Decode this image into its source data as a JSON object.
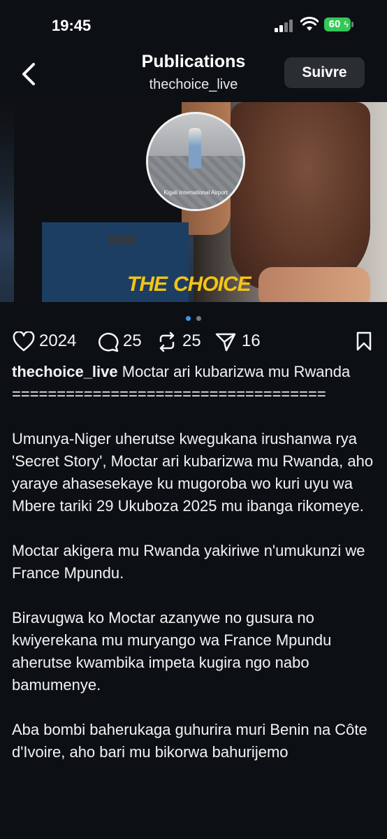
{
  "status_bar": {
    "time": "19:45",
    "battery": "60"
  },
  "header": {
    "title": "Publications",
    "subtitle": "thechoice_live",
    "follow_label": "Suivre"
  },
  "post": {
    "inset_caption": "Kigali International Airport",
    "logo_the": "THE",
    "logo_choice": "CHOICE",
    "carousel": {
      "count": 2,
      "active": 0
    },
    "colors": {
      "logo": "#f3c417",
      "dot_active": "#3897f0",
      "dot_inactive": "#7a7a7a"
    }
  },
  "actions": {
    "likes": "2024",
    "comments": "25",
    "reposts": "25",
    "shares": "16"
  },
  "caption": {
    "username": "thechoice_live",
    "headline": "Moctar ari kubarizwa mu Rwanda",
    "separator": "===================================",
    "paragraphs": [
      "Umunya-Niger uherutse kwegukana irushanwa rya 'Secret Story', Moctar ari kubarizwa mu Rwanda, aho yaraye ahasesekaye ku mugoroba wo kuri uyu wa Mbere tariki 29 Ukuboza 2025 mu ibanga rikomeye.",
      "Moctar akigera mu Rwanda yakiriwe n'umukunzi we France Mpundu.",
      "Biravugwa ko Moctar azanywe no gusura no kwiyerekana mu muryango wa France Mpundu aherutse kwambika impeta kugira ngo nabo bamumenye.",
      "Aba bombi baherukaga guhurira muri Benin na Côte d'Ivoire, aho bari mu bikorwa bahurijemo"
    ]
  }
}
